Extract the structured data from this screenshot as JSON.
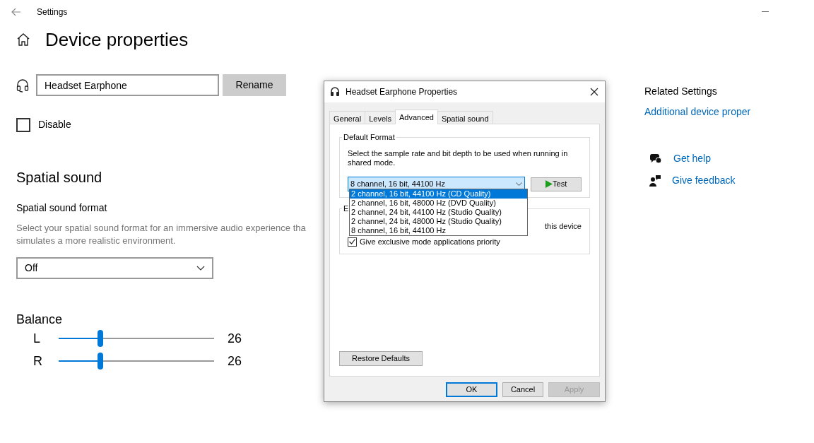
{
  "window": {
    "title": "Settings"
  },
  "page": {
    "title": "Device properties",
    "device_name": "Headset Earphone",
    "rename_button": "Rename",
    "disable": {
      "label": "Disable",
      "checked": false
    },
    "spatial": {
      "heading": "Spatial sound",
      "label": "Spatial sound format",
      "description_lines": [
        "Select your spatial sound format for an immersive audio experience tha",
        "simulates a more realistic environment."
      ],
      "value": "Off"
    },
    "balance": {
      "heading": "Balance",
      "channels": [
        {
          "label": "L",
          "level": 0.27,
          "reading": "26"
        },
        {
          "label": "R",
          "level": 0.27,
          "reading": "26"
        }
      ]
    }
  },
  "related": {
    "heading": "Related Settings",
    "links": [
      "Additional device proper"
    ]
  },
  "help_links": [
    {
      "kind": "help",
      "label": "Get help"
    },
    {
      "kind": "feedback",
      "label": "Give feedback"
    }
  ],
  "dialog": {
    "title": "Headset Earphone Properties",
    "tabs": [
      {
        "label": "General",
        "selected": false
      },
      {
        "label": "Levels",
        "selected": false
      },
      {
        "label": "Advanced",
        "selected": true
      },
      {
        "label": "Spatial sound",
        "selected": false
      }
    ],
    "default_format": {
      "legend": "Default Format",
      "description": "Select the sample rate and bit depth to be used when running in shared mode.",
      "value": "8 channel, 16 bit, 44100 Hz",
      "test_button": "Test",
      "options": [
        {
          "label": "2 channel, 16 bit, 44100 Hz (CD Quality)",
          "highlighted": true
        },
        {
          "label": "2 channel, 16 bit, 48000 Hz (DVD Quality)",
          "highlighted": false
        },
        {
          "label": "2 channel, 24 bit, 44100 Hz (Studio Quality)",
          "highlighted": false
        },
        {
          "label": "2 channel, 24 bit, 48000 Hz (Studio Quality)",
          "highlighted": false
        },
        {
          "label": "8 channel, 16 bit, 44100 Hz",
          "highlighted": false
        }
      ]
    },
    "exclusive": {
      "legend": "E",
      "covered_row_tail": "this device",
      "options": [
        {
          "label": "Give exclusive mode applications priority",
          "checked": true
        }
      ]
    },
    "restore_button": "Restore Defaults",
    "buttons": [
      {
        "label": "OK",
        "default": true,
        "disabled": false
      },
      {
        "label": "Cancel",
        "default": false,
        "disabled": false
      },
      {
        "label": "Apply",
        "default": false,
        "disabled": true
      }
    ]
  }
}
